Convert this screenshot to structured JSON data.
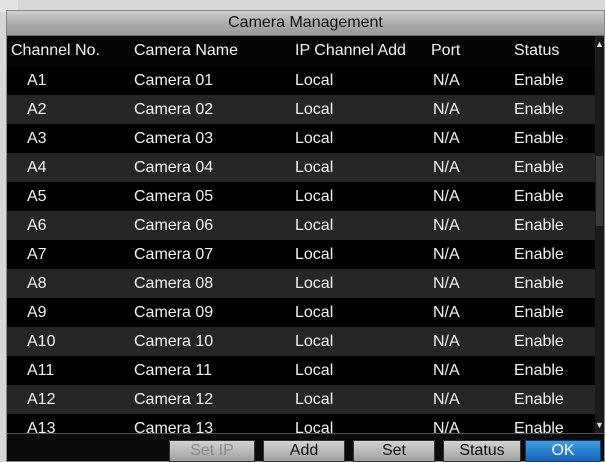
{
  "window": {
    "title": "Camera Management"
  },
  "table": {
    "headers": [
      "Channel No.",
      "Camera Name",
      "IP Channel Add",
      "Port",
      "Status"
    ],
    "rows": [
      [
        "A1",
        "Camera 01",
        "Local",
        "N/A",
        "Enable"
      ],
      [
        "A2",
        "Camera 02",
        "Local",
        "N/A",
        "Enable"
      ],
      [
        "A3",
        "Camera 03",
        "Local",
        "N/A",
        "Enable"
      ],
      [
        "A4",
        "Camera 04",
        "Local",
        "N/A",
        "Enable"
      ],
      [
        "A5",
        "Camera 05",
        "Local",
        "N/A",
        "Enable"
      ],
      [
        "A6",
        "Camera 06",
        "Local",
        "N/A",
        "Enable"
      ],
      [
        "A7",
        "Camera 07",
        "Local",
        "N/A",
        "Enable"
      ],
      [
        "A8",
        "Camera 08",
        "Local",
        "N/A",
        "Enable"
      ],
      [
        "A9",
        "Camera 09",
        "Local",
        "N/A",
        "Enable"
      ],
      [
        "A10",
        "Camera 10",
        "Local",
        "N/A",
        "Enable"
      ],
      [
        "A11",
        "Camera 11",
        "Local",
        "N/A",
        "Enable"
      ],
      [
        "A12",
        "Camera 12",
        "Local",
        "N/A",
        "Enable"
      ],
      [
        "A13",
        "Camera 13",
        "Local",
        "N/A",
        "Enable"
      ]
    ]
  },
  "scrollbar": {
    "up_icon": "chevron-up-icon",
    "down_icon": "chevron-down-icon"
  },
  "buttons": {
    "set_ip": "Set IP",
    "add": "Add",
    "set": "Set",
    "status": "Status",
    "ok": "OK"
  },
  "colors": {
    "background": "#000000",
    "row_alt": "#262626",
    "title_bar": "#b0b0b0",
    "primary_button": "#1e7fd6"
  }
}
